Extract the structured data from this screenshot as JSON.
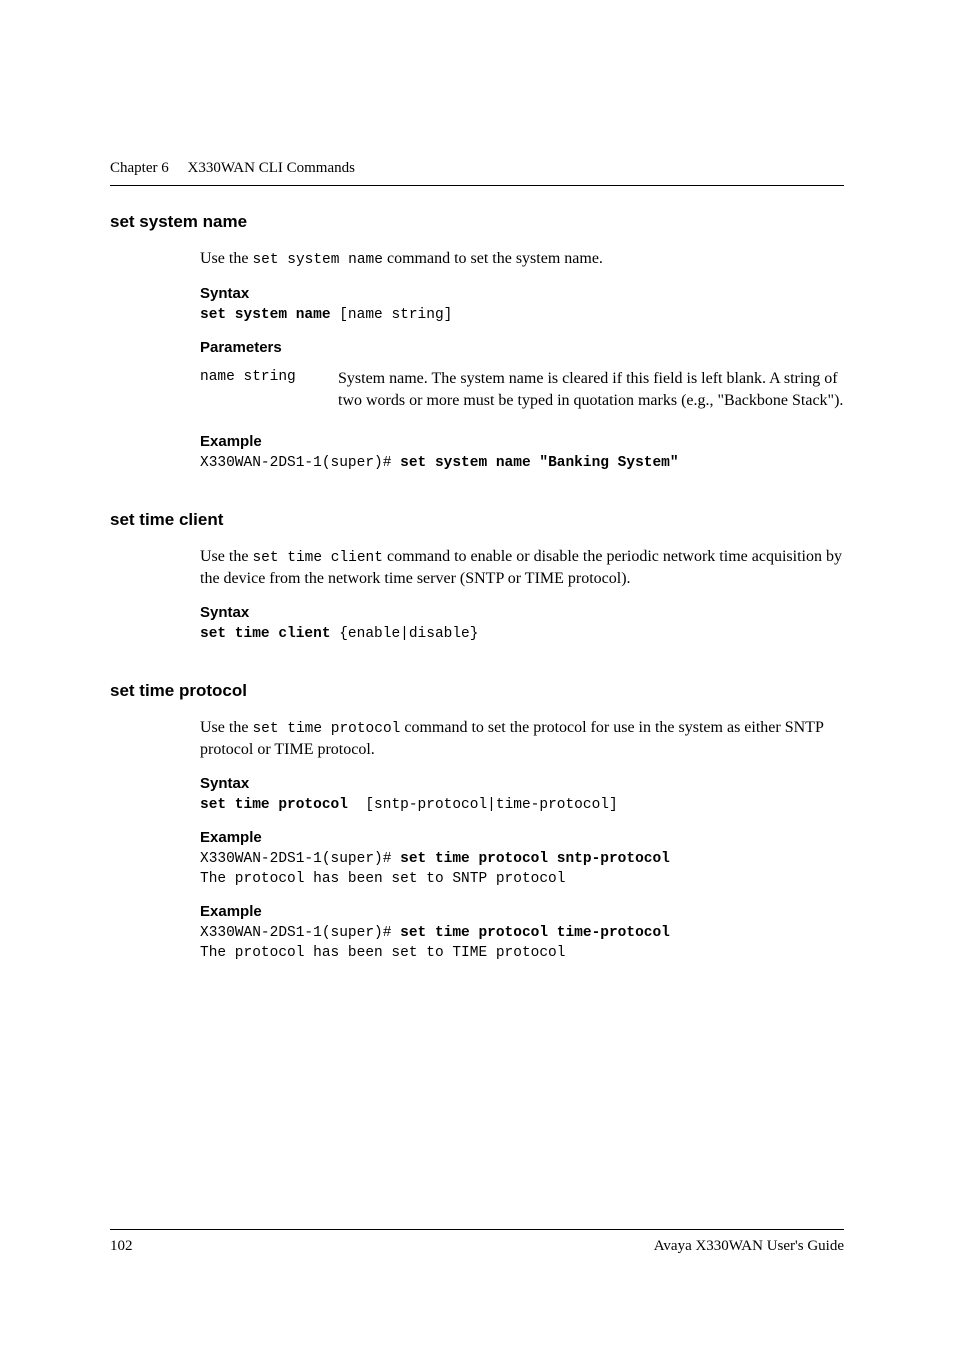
{
  "header": {
    "chapter": "Chapter 6",
    "title": "X330WAN CLI Commands"
  },
  "sections": [
    {
      "title": "set system name",
      "intro_pre": "Use the ",
      "intro_code": "set system name",
      "intro_post": " command to set the system name.",
      "syntax_label": "Syntax",
      "syntax_cmd": "set system name",
      "syntax_args": " [name string]",
      "params_label": "Parameters",
      "params": [
        {
          "key": " name string",
          "desc": "System name. The system name is cleared if this field is left blank. A string of two words or more must be typed in quotation marks (e.g., \"Backbone Stack\")."
        }
      ],
      "example_label": "Example",
      "example_prompt": "X330WAN-2DS1-1(super)# ",
      "example_cmd": "set system name \"Banking System\""
    },
    {
      "title": "set time client",
      "intro_pre": "Use the ",
      "intro_code": "set time client",
      "intro_post": " command to enable or disable the periodic network time acquisition by the device from the network time server (SNTP or TIME protocol).",
      "syntax_label": "Syntax",
      "syntax_cmd": "set time client",
      "syntax_args": " {enable|disable}"
    },
    {
      "title": "set time protocol",
      "intro_pre": "Use the ",
      "intro_code": "set time protocol",
      "intro_post": " command to set the protocol for use in the system as either SNTP protocol or TIME protocol.",
      "syntax_label": "Syntax",
      "syntax_cmd": "set time protocol",
      "syntax_args": "  [sntp-protocol|time-protocol]",
      "example1_label": "Example",
      "example1_prompt": "X330WAN-2DS1-1(super)# ",
      "example1_cmd": "set time protocol sntp-protocol",
      "example1_out": "The protocol has been set to SNTP protocol",
      "example2_label": "Example",
      "example2_prompt": "X330WAN-2DS1-1(super)# ",
      "example2_cmd": "set time protocol time-protocol",
      "example2_out": "The protocol has been set to TIME protocol"
    }
  ],
  "footer": {
    "page": "102",
    "guide": "Avaya X330WAN User's Guide"
  }
}
